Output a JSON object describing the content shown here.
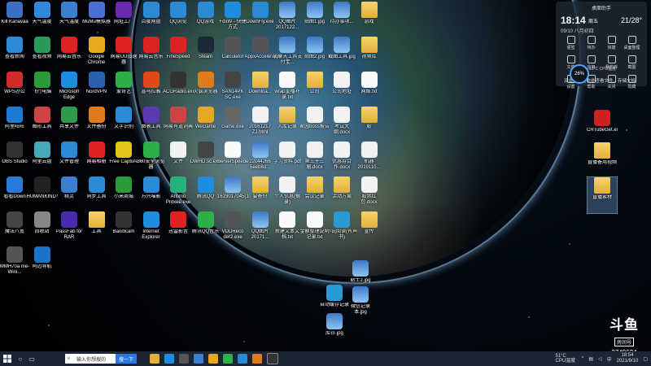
{
  "widget": {
    "header": "桌面助手",
    "time": "18:14",
    "weekday": "周五",
    "date": "09/10 八月初四",
    "temp": "21/28°",
    "cells": [
      "便签",
      "待办",
      "快捷",
      "桌面整理",
      "文件",
      "应用",
      "我的库",
      "截图",
      "设置",
      "帮助",
      "关闭",
      "隐藏"
    ],
    "footer": "双击桌面空白处查看文件、存储文档",
    "cpu_percent": "26%",
    "cpu_temp": "51°C CPU温度"
  },
  "col1": [
    {
      "label": "Kill Kanavaa",
      "kind": "app",
      "color": "#3b6fc4"
    },
    {
      "label": "查看新闻",
      "kind": "app",
      "color": "#2a8ad6"
    },
    {
      "label": "WPS办公",
      "kind": "app",
      "color": "#d22b2b"
    },
    {
      "label": "阿里旺旺",
      "kind": "app",
      "color": "#1b7bd2"
    },
    {
      "label": "OBS Studio",
      "kind": "app",
      "color": "#333"
    },
    {
      "label": "看看Down",
      "kind": "app",
      "color": "#2a7bd8"
    },
    {
      "label": "魔法八宽",
      "kind": "app",
      "color": "#444"
    },
    {
      "label": "MMH70a me-Wini...",
      "kind": "app",
      "color": "#555"
    }
  ],
  "col2": [
    {
      "label": "天气温度",
      "kind": "app",
      "color": "#2e89d8"
    },
    {
      "label": "查看视频",
      "kind": "app",
      "color": "#2a9a5a"
    },
    {
      "label": "飞行电脑",
      "kind": "app",
      "color": "#2b9a3a"
    },
    {
      "label": "图形工具",
      "kind": "app",
      "color": "#c44"
    },
    {
      "label": "阿里云盘",
      "kind": "app",
      "color": "#4ab"
    },
    {
      "label": "HUMANKIND™",
      "kind": "app",
      "color": "#222"
    },
    {
      "label": "回收站",
      "kind": "app",
      "color": "#888"
    },
    {
      "label": "阿迈导航",
      "kind": "app",
      "color": "#1a73c9"
    }
  ],
  "col3": [
    {
      "label": "天气温度",
      "kind": "app",
      "color": "#3a7fd0"
    },
    {
      "label": "网易云音乐",
      "kind": "app",
      "color": "#d22"
    },
    {
      "label": "Microsoft Edge",
      "kind": "app",
      "color": "#1e8de0"
    },
    {
      "label": "共享文件",
      "kind": "app",
      "color": "#2f9a4a"
    },
    {
      "label": "文件管理",
      "kind": "app",
      "color": "#2a8ad6"
    },
    {
      "label": "精灵",
      "kind": "app",
      "color": "#3a7fd0"
    },
    {
      "label": "PassFab for RAR",
      "kind": "app",
      "color": "#4a2bb0"
    }
  ],
  "col4": [
    {
      "label": "MuMu模拟器",
      "kind": "app",
      "color": "#4a6fd6"
    },
    {
      "label": "Google Chrome",
      "kind": "app",
      "color": "#e5a91b"
    },
    {
      "label": "NordVPN",
      "kind": "app",
      "color": "#2b5fb0"
    },
    {
      "label": "文件备份",
      "kind": "app",
      "color": "#e07a1b"
    },
    {
      "label": "网易相册",
      "kind": "app",
      "color": "#d22"
    },
    {
      "label": "同步工具",
      "kind": "app",
      "color": "#2a8ad6"
    },
    {
      "label": "工具",
      "kind": "folder",
      "color": "#e2b03b"
    }
  ],
  "col5": [
    {
      "label": "网址工厂",
      "kind": "app",
      "color": "#6a2bb0"
    },
    {
      "label": "网易UU加速器",
      "kind": "app",
      "color": "#d22"
    },
    {
      "label": "爱奇艺",
      "kind": "app",
      "color": "#2bb04a"
    },
    {
      "label": "文字识别",
      "kind": "app",
      "color": "#2a8ad6"
    },
    {
      "label": "Free Capture",
      "kind": "app",
      "color": "#e5c41b"
    },
    {
      "label": "小米商城",
      "kind": "app",
      "color": "#2b9a3a"
    },
    {
      "label": "Bandicam",
      "kind": "app",
      "color": "#333"
    }
  ],
  "col6": [
    {
      "label": "百度网盘",
      "kind": "app",
      "color": "#2a8ad6"
    },
    {
      "label": "网易云音乐",
      "kind": "app",
      "color": "#d22"
    },
    {
      "label": "喜马拉雅",
      "kind": "app",
      "color": "#e04a1b"
    },
    {
      "label": "图表工具",
      "kind": "app",
      "color": "#5a3ab0"
    },
    {
      "label": "360安全浏览器",
      "kind": "app",
      "color": "#2bb04a"
    },
    {
      "label": "万兴喵影",
      "kind": "app",
      "color": "#2a8ad6"
    },
    {
      "label": "Internet Explorer",
      "kind": "app",
      "color": "#1e8de0"
    }
  ],
  "col7": [
    {
      "label": "QQ浏览",
      "kind": "app",
      "color": "#2a8ad6"
    },
    {
      "label": "FineSpeed",
      "kind": "app",
      "color": "#d22"
    },
    {
      "label": "ACGRadio.exe",
      "kind": "app",
      "color": "#333"
    },
    {
      "label": "网易有道词典",
      "kind": "app",
      "color": "#c44"
    },
    {
      "label": "文件",
      "kind": "doc",
      "color": "#fff"
    },
    {
      "label": "Antimo Proxee.exe",
      "kind": "app",
      "color": "#2ab07a"
    },
    {
      "label": "迅雷影音",
      "kind": "app",
      "color": "#d22"
    }
  ],
  "col8": [
    {
      "label": "QQ游戏",
      "kind": "app",
      "color": "#2a8ad6"
    },
    {
      "label": "Steam",
      "kind": "app",
      "color": "#1b2838"
    },
    {
      "label": "火狐浏览器",
      "kind": "app",
      "color": "#e07a1b"
    },
    {
      "label": "WeGame",
      "kind": "app",
      "color": "#e5a91b"
    },
    {
      "label": "DWHD.sc.exe",
      "kind": "app",
      "color": "#444"
    },
    {
      "label": "腾讯QQ",
      "kind": "app",
      "color": "#1e8de0"
    },
    {
      "label": "腾讯QQ音乐",
      "kind": "app",
      "color": "#2bb04a"
    }
  ],
  "col9": [
    {
      "label": "FdxW - 快捷方式",
      "kind": "app",
      "color": "#1e8de0"
    },
    {
      "label": "Calculator",
      "kind": "app",
      "color": "#555"
    },
    {
      "label": "SAN14PK SC.exe",
      "kind": "app",
      "color": "#444"
    },
    {
      "label": "Game.exe",
      "kind": "app",
      "color": "#666"
    },
    {
      "label": "ServerSpeeder.bat",
      "kind": "txt",
      "color": "#fff"
    },
    {
      "label": "1619017045(1).jpg",
      "kind": "img",
      "color": "#fff"
    },
    {
      "label": "VDDReco der2.exe",
      "kind": "app",
      "color": "#555"
    }
  ],
  "col10": [
    {
      "label": "DownFly.exe",
      "kind": "app",
      "color": "#2a8ad6"
    },
    {
      "label": "AppxAccelerator.exe",
      "kind": "app",
      "color": "#555"
    },
    {
      "label": "Downloa...",
      "kind": "folder",
      "color": "#e2b03b"
    },
    {
      "label": "20161217 ZJ.html",
      "kind": "doc",
      "color": "#fff"
    },
    {
      "label": "22c44266 5eeb8d...",
      "kind": "img",
      "color": "#fff"
    },
    {
      "label": "要备份",
      "kind": "folder",
      "color": "#e2b03b"
    },
    {
      "label": "QQ图片 20171...",
      "kind": "img",
      "color": "#fff"
    }
  ],
  "col11": [
    {
      "label": "QQ图片 2017122...",
      "kind": "img",
      "color": "#fff"
    },
    {
      "label": "qq聊天工具支付宝...",
      "kind": "img",
      "color": "#fff"
    },
    {
      "label": "wrap重播补录.txt",
      "kind": "txt",
      "color": "#fff"
    },
    {
      "label": "入库记录",
      "kind": "folder",
      "color": "#e2b03b"
    },
    {
      "label": "学习资料.pdf",
      "kind": "doc",
      "color": "#fff"
    },
    {
      "label": "个人信息(摘录)",
      "kind": "doc",
      "color": "#fff"
    },
    {
      "label": "新建文本文档.txt",
      "kind": "txt",
      "color": "#fff"
    }
  ],
  "col12": [
    {
      "label": "贴图1.jpg",
      "kind": "img",
      "color": "#fff"
    },
    {
      "label": "贴图2.jpg",
      "kind": "img",
      "color": "#fff"
    },
    {
      "label": "公司",
      "kind": "folder",
      "color": "#e2b03b"
    },
    {
      "label": "家园boss报告",
      "kind": "doc",
      "color": "#fff"
    },
    {
      "label": "第三十三届.docx",
      "kind": "doc",
      "color": "#fff"
    },
    {
      "label": "会议记录",
      "kind": "folder",
      "color": "#e2b03b"
    },
    {
      "label": "金额整理说明记录.txt",
      "kind": "txt",
      "color": "#fff"
    }
  ],
  "col13": [
    {
      "label": "待办事项...",
      "kind": "img",
      "color": "#fff"
    },
    {
      "label": "截图工具.jpg",
      "kind": "img",
      "color": "#fff"
    },
    {
      "label": "公司地址",
      "kind": "doc",
      "color": "#fff"
    },
    {
      "label": "考试大纲.docx",
      "kind": "doc",
      "color": "#fff"
    },
    {
      "label": "优惠券合作.docx",
      "kind": "doc",
      "color": "#fff"
    },
    {
      "label": "活动方案",
      "kind": "folder",
      "color": "#e2b03b"
    },
    {
      "label": "小说阅读(有声书)",
      "kind": "app",
      "color": "#2a9ad6"
    }
  ],
  "col14": [
    {
      "label": "游戏",
      "kind": "folder",
      "color": "#e2b03b"
    },
    {
      "label": "视频库",
      "kind": "folder",
      "color": "#e2b03b"
    },
    {
      "label": "网络.txt",
      "kind": "txt",
      "color": "#fff"
    },
    {
      "label": "股",
      "kind": "folder",
      "color": "#e2b03b"
    },
    {
      "label": "机器 2019110...",
      "kind": "doc",
      "color": "#fff"
    },
    {
      "label": "股票红包.docx",
      "kind": "doc",
      "color": "#fff"
    },
    {
      "label": "宣传",
      "kind": "folder",
      "color": "#e2b03b"
    }
  ],
  "scattered": [
    {
      "label": "贴士2.jpg",
      "kind": "img",
      "color": "#fff"
    },
    {
      "label": "自动缓存记录",
      "kind": "app",
      "color": "#2a9ad6"
    },
    {
      "label": "微信记录本.jpg",
      "kind": "img",
      "color": "#fff"
    },
    {
      "label": "库存.jpg",
      "kind": "img",
      "color": "#fff"
    }
  ],
  "right": [
    {
      "label": "CRTubeGet.exe",
      "kind": "app",
      "color": "#c22"
    },
    {
      "label": "直播备用视频",
      "kind": "folder",
      "color": "#e2b03b"
    },
    {
      "label": "直播素材",
      "kind": "folder",
      "color": "#e2b03b"
    }
  ],
  "douyu": {
    "logo": "斗鱼",
    "sub": "房间号",
    "room": "3749634"
  },
  "taskbar": {
    "search_placeholder": "输入你想搜的",
    "search_button": "搜一下",
    "cpu_temp": "51°C CPU温度",
    "time": "18:54",
    "date": "2021/9/10"
  }
}
